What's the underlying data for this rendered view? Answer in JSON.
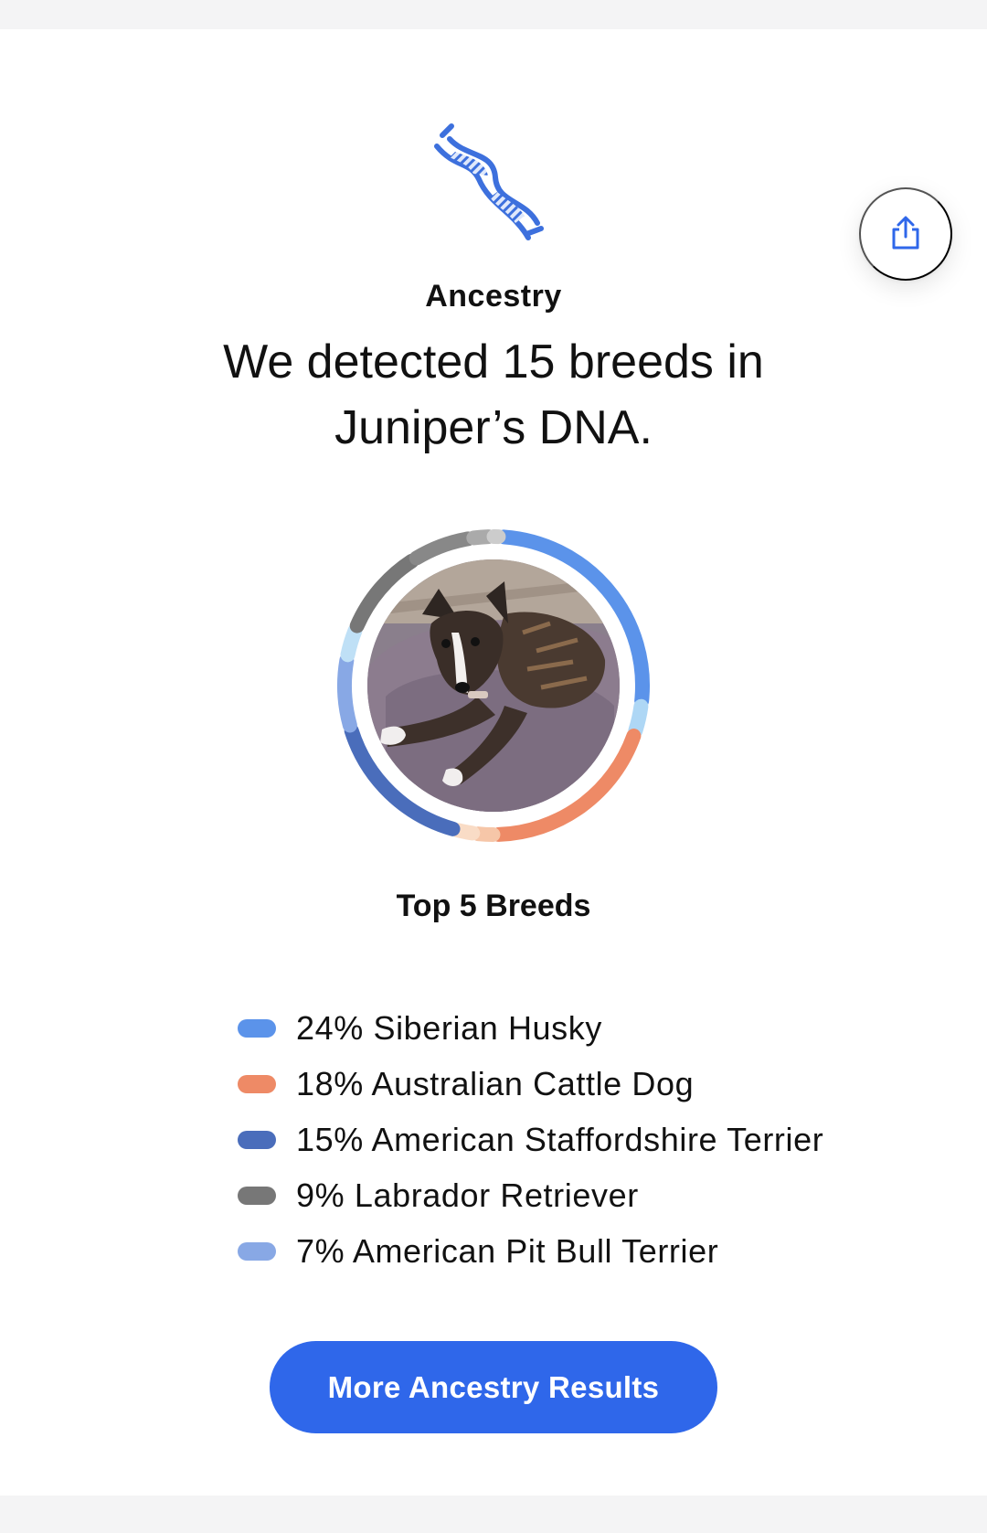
{
  "header": {
    "icon": "dna-icon",
    "share_icon": "share-icon",
    "section_title": "Ancestry",
    "headline": "We detected 15 breeds in Juniper’s DNA."
  },
  "chart_data": {
    "type": "donut",
    "center_image": "dog-photo",
    "segments": [
      {
        "value": 24,
        "color": "#5b93ea"
      },
      {
        "value": 3,
        "color": "#aed7f5"
      },
      {
        "value": 18,
        "color": "#ee8a66"
      },
      {
        "value": 2,
        "color": "#f6c6a8"
      },
      {
        "value": 2,
        "color": "#f9dcc6"
      },
      {
        "value": 15,
        "color": "#4a6dbb"
      },
      {
        "value": 7,
        "color": "#88a8e5"
      },
      {
        "value": 3,
        "color": "#bfe0f6"
      },
      {
        "value": 9,
        "color": "#777777"
      },
      {
        "value": 6,
        "color": "#888888"
      },
      {
        "value": 2,
        "color": "#aaaaaa"
      },
      {
        "value": 1,
        "color": "#cccccc"
      }
    ]
  },
  "top_breeds": {
    "title": "Top 5 Breeds",
    "items": [
      {
        "label": "24% Siberian Husky",
        "color": "#5b93ea"
      },
      {
        "label": "18% Australian Cattle Dog",
        "color": "#ee8a66"
      },
      {
        "label": "15% American Staffordshire Terrier",
        "color": "#4a6dbb"
      },
      {
        "label": "9% Labrador Retriever",
        "color": "#777777"
      },
      {
        "label": "7% American Pit Bull Terrier",
        "color": "#88a8e5"
      }
    ]
  },
  "actions": {
    "more_label": "More Ancestry Results"
  }
}
